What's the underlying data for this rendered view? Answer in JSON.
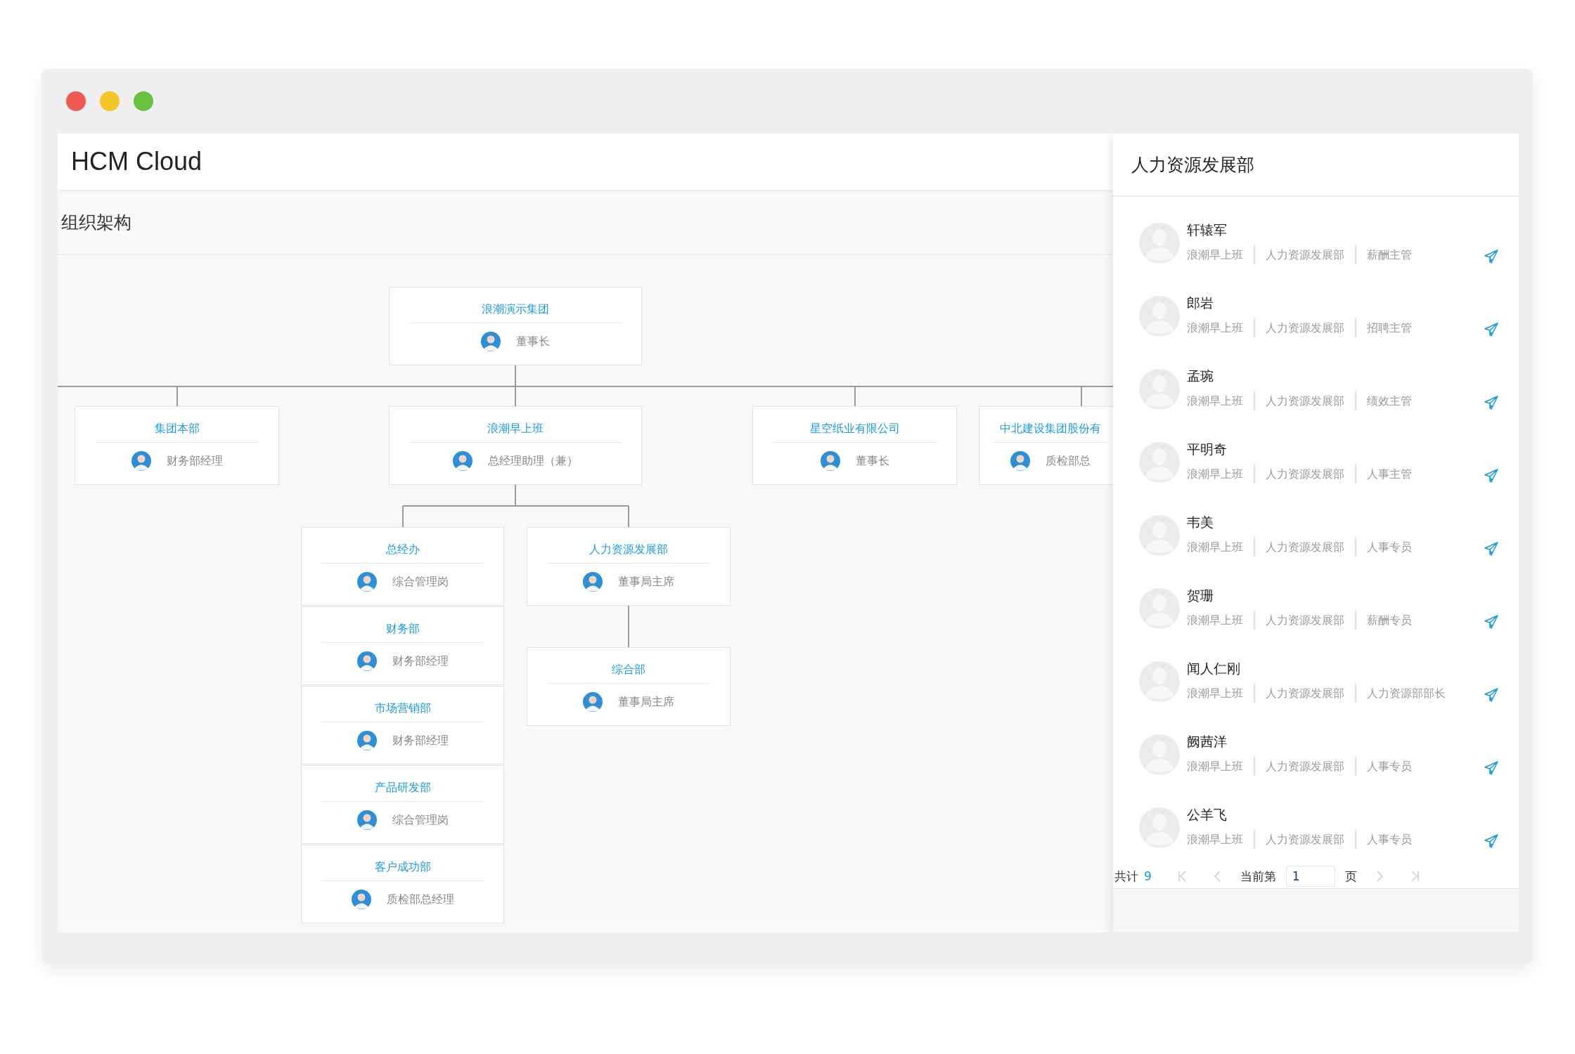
{
  "app_title": "HCM Cloud",
  "page_title": "组织架构",
  "org_chart": {
    "title": "浪潮演示集团",
    "role": "董事长",
    "children": [
      {
        "title": "集团本部",
        "role": "财务部经理"
      },
      {
        "title": "浪潮早上班",
        "role": "总经理助理（兼）",
        "children": [
          {
            "title": "总经办",
            "role": "综合管理岗",
            "stack": [
              {
                "title": "财务部",
                "role": "财务部经理"
              },
              {
                "title": "市场营销部",
                "role": "财务部经理"
              },
              {
                "title": "产品研发部",
                "role": "综合管理岗"
              },
              {
                "title": "客户成功部",
                "role": "质检部总经理"
              }
            ]
          },
          {
            "title": "人力资源发展部",
            "role": "董事局主席",
            "children": [
              {
                "title": "综合部",
                "role": "董事局主席"
              }
            ]
          }
        ]
      },
      {
        "title": "星空纸业有限公司",
        "role": "董事长"
      },
      {
        "title": "中北建设集团股份有",
        "role": "质检部总"
      }
    ]
  },
  "panel": {
    "title": "人力资源发展部",
    "members": [
      {
        "name": "轩辕军",
        "company": "浪潮早上班",
        "department": "人力资源发展部",
        "position": "薪酬主管"
      },
      {
        "name": "郎岩",
        "company": "浪潮早上班",
        "department": "人力资源发展部",
        "position": "招聘主管"
      },
      {
        "name": "孟琬",
        "company": "浪潮早上班",
        "department": "人力资源发展部",
        "position": "绩效主管"
      },
      {
        "name": "平明奇",
        "company": "浪潮早上班",
        "department": "人力资源发展部",
        "position": "人事主管"
      },
      {
        "name": "韦美",
        "company": "浪潮早上班",
        "department": "人力资源发展部",
        "position": "人事专员"
      },
      {
        "name": "贺珊",
        "company": "浪潮早上班",
        "department": "人力资源发展部",
        "position": "薪酬专员"
      },
      {
        "name": "闻人仁刚",
        "company": "浪潮早上班",
        "department": "人力资源发展部",
        "position": "人力资源部部长"
      },
      {
        "name": "阙茜洋",
        "company": "浪潮早上班",
        "department": "人力资源发展部",
        "position": "人事专员"
      },
      {
        "name": "公羊飞",
        "company": "浪潮早上班",
        "department": "人力资源发展部",
        "position": "人事专员"
      }
    ],
    "pagination": {
      "total_label": "共计",
      "total": "9",
      "page_label": "当前第",
      "page": "1",
      "page_unit": "页"
    }
  }
}
